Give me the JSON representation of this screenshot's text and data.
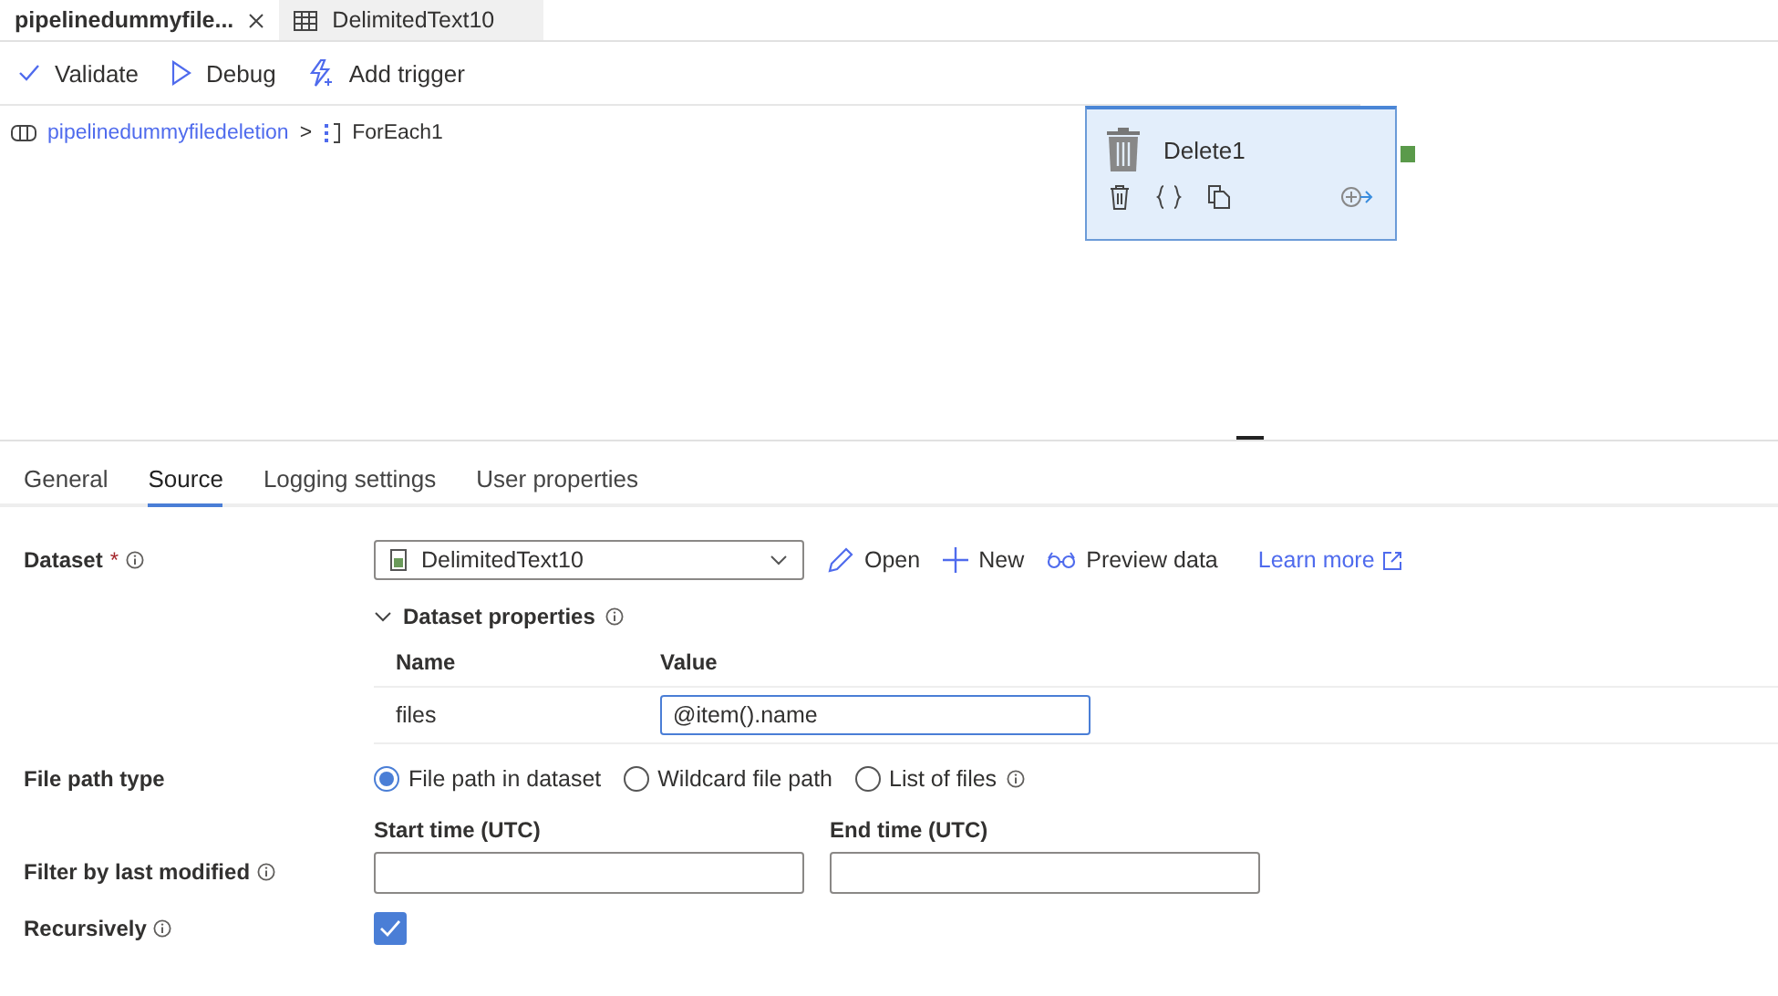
{
  "document_tabs": [
    {
      "label": "pipelinedummyfile...",
      "selected": true
    },
    {
      "label": "DelimitedText10",
      "kind": "dataset",
      "selected": false
    }
  ],
  "toolbar": [
    {
      "label": "Validate",
      "kind": "validate"
    },
    {
      "label": "Debug",
      "kind": "debug"
    },
    {
      "label": "Add trigger",
      "kind": "trigger"
    }
  ],
  "breadcrumb": {
    "separator": ">",
    "items": [
      {
        "label": "pipelinedummyfiledeletion",
        "kind": "pipeline"
      },
      {
        "label": "ForEach1",
        "kind": "foreach"
      }
    ]
  },
  "activity": {
    "name": "Delete1"
  },
  "panel_tabs": [
    {
      "label": "General",
      "selected": false
    },
    {
      "label": "Source",
      "selected": true
    },
    {
      "label": "Logging settings",
      "selected": false
    },
    {
      "label": "User properties",
      "selected": false
    }
  ],
  "dataset": {
    "label": "Dataset",
    "required_mark": "*",
    "info": true,
    "value": "DelimitedText10",
    "actions": [
      {
        "label": "Open",
        "kind": "edit"
      },
      {
        "label": "New",
        "kind": "add"
      },
      {
        "label": "Preview data",
        "kind": "preview"
      }
    ],
    "learn_more": "Learn more"
  },
  "dataset_properties": {
    "title": "Dataset properties",
    "info": true,
    "expanded": true,
    "columns": [
      "Name",
      "Value"
    ],
    "rows": [
      {
        "name": "files",
        "value": "@item().name"
      }
    ]
  },
  "file_path_type": {
    "label": "File path type",
    "options": [
      {
        "label": "File path in dataset",
        "selected": true,
        "info": false
      },
      {
        "label": "Wildcard file path",
        "selected": false,
        "info": false
      },
      {
        "label": "List of files",
        "selected": false,
        "info": true
      }
    ]
  },
  "filter_by_last_modified": {
    "label": "Filter by last modified",
    "info": true,
    "fields": [
      {
        "label": "Start time (UTC)"
      },
      {
        "label": "End time (UTC)"
      }
    ]
  },
  "recursively": {
    "label": "Recursively",
    "info": true,
    "checked": true
  }
}
